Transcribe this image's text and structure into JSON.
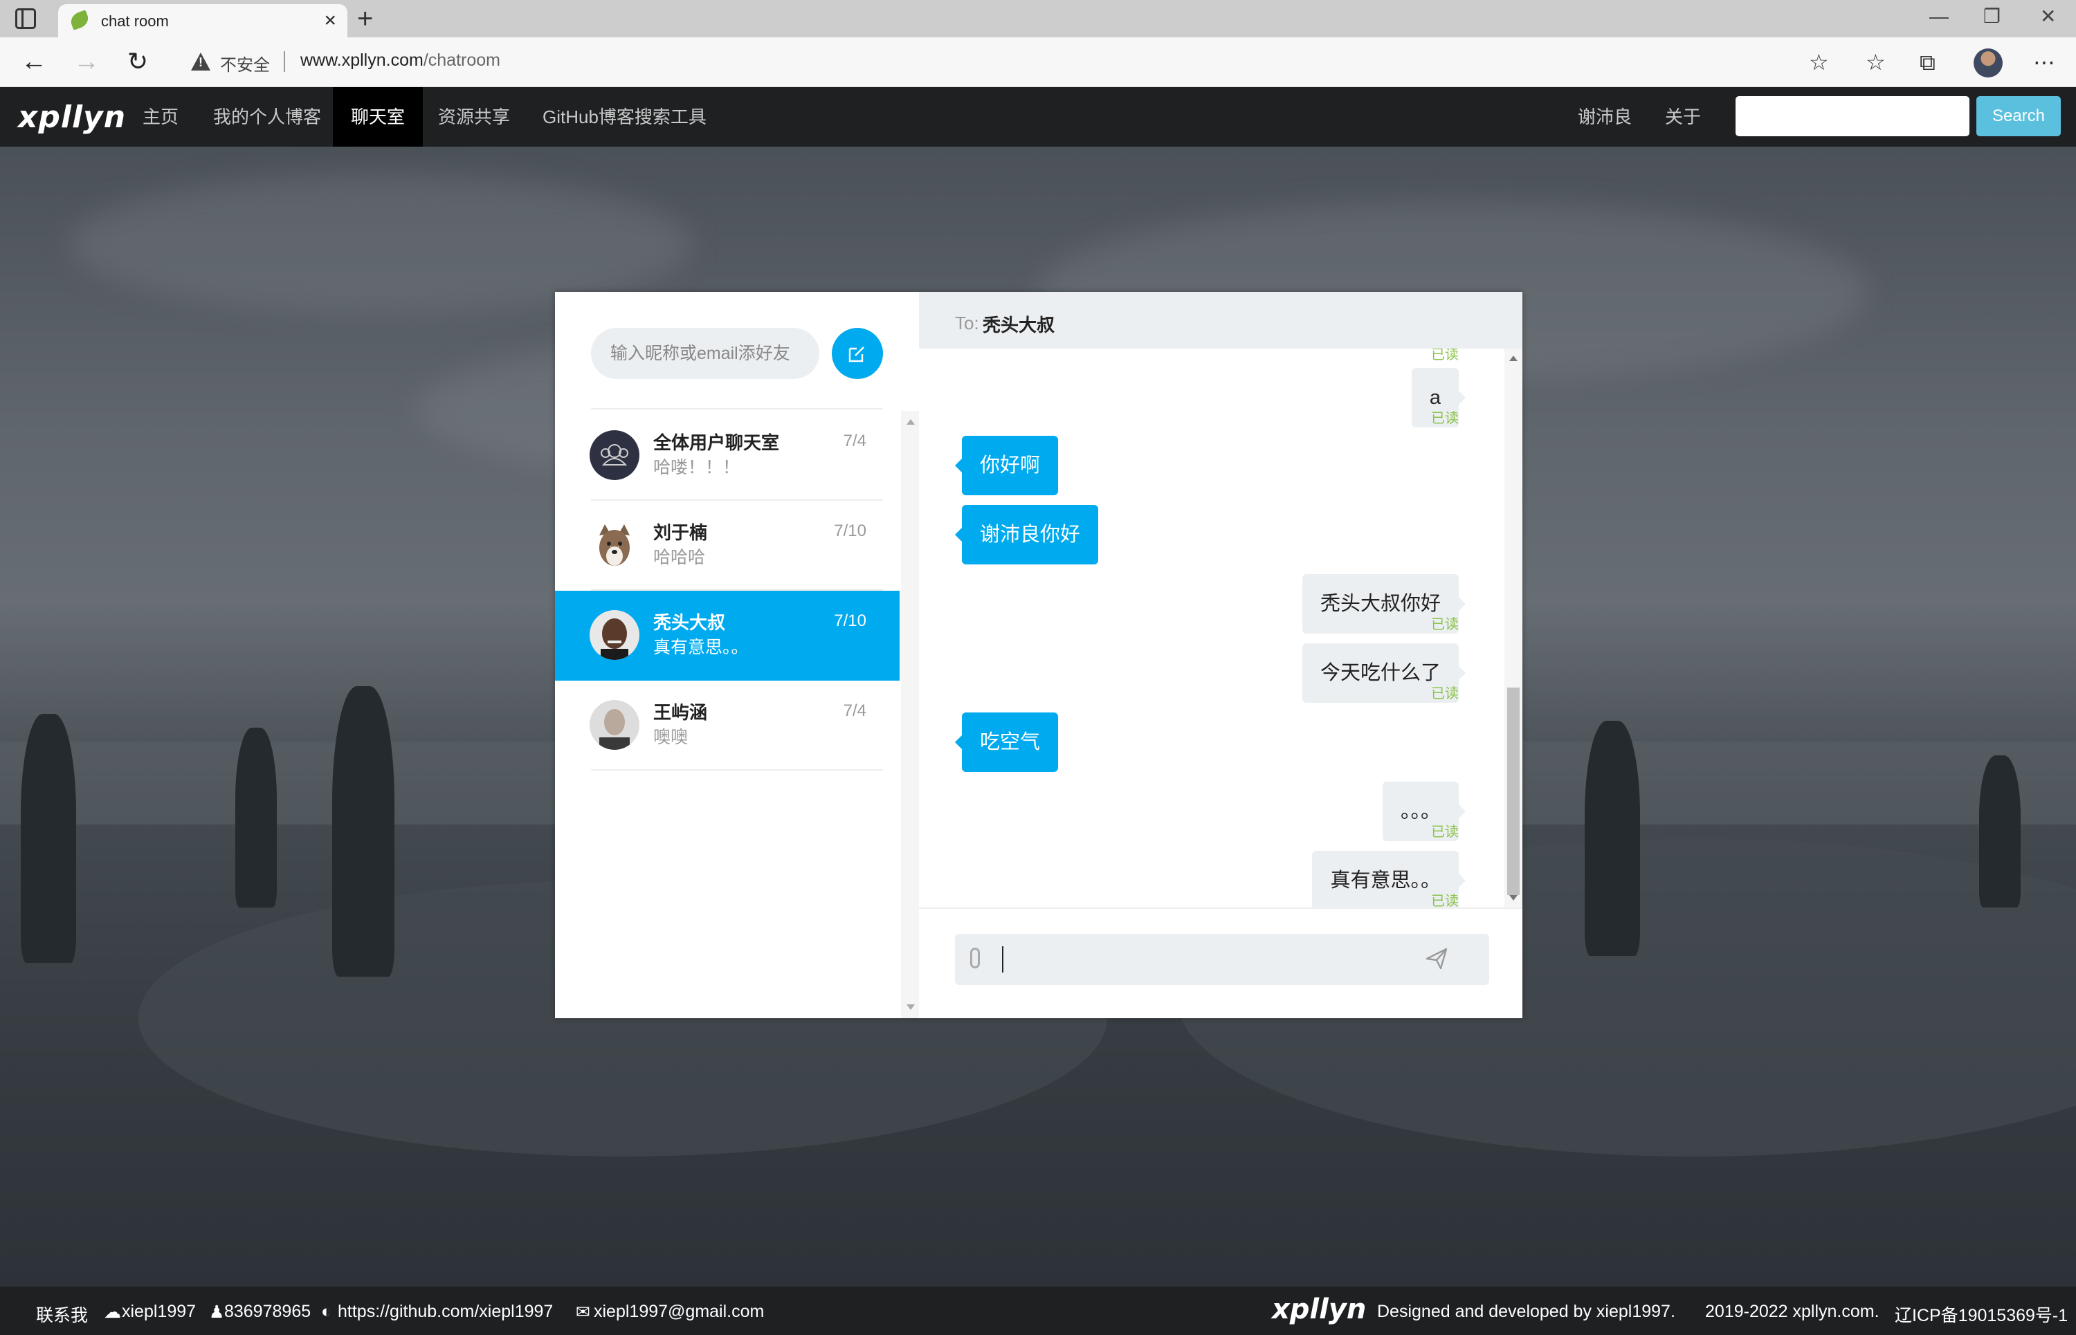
{
  "browser": {
    "tab_title": "chat room",
    "tab_close": "×",
    "new_tab": "+",
    "window_controls": [
      "—",
      "❐",
      "✕"
    ],
    "insecure_label": "不安全",
    "url_host": "www.xpllyn.com",
    "url_path": "/chatroom"
  },
  "site": {
    "logo": "xpllyn",
    "nav": [
      "主页",
      "我的个人博客",
      "聊天室",
      "资源共享",
      "GitHub博客搜索工具"
    ],
    "active_nav": "聊天室",
    "user": "谢沛良",
    "about": "关于",
    "search_value": "",
    "search_button": "Search"
  },
  "chat": {
    "add_friend_placeholder": "输入昵称或email添好友",
    "contacts": [
      {
        "name": "全体用户聊天室",
        "last": "哈喽！！！",
        "date": "7/4",
        "avatar": "group-icon"
      },
      {
        "name": "刘于楠",
        "last": "哈哈哈",
        "date": "7/10",
        "avatar": "husky-avatar"
      },
      {
        "name": "秃头大叔",
        "last": "真有意思。。",
        "date": "7/10",
        "avatar": "man-avatar",
        "active": true
      },
      {
        "name": "王屿涵",
        "last": "噢噢",
        "date": "7/4",
        "avatar": "person-avatar"
      }
    ],
    "to_label": "To:",
    "to_name": "秃头大叔",
    "messages": [
      {
        "dir": "out",
        "text": "a",
        "read": "已读"
      },
      {
        "dir": "in",
        "text": "你好啊"
      },
      {
        "dir": "in",
        "text": "谢沛良你好"
      },
      {
        "dir": "out",
        "text": "秃头大叔你好",
        "read": "已读"
      },
      {
        "dir": "out",
        "text": "今天吃什么了",
        "read": "已读"
      },
      {
        "dir": "in",
        "text": "吃空气"
      },
      {
        "dir": "out",
        "text": "。。。",
        "read": "已读"
      },
      {
        "dir": "out",
        "text": "真有意思。。",
        "read": "已读"
      }
    ],
    "top_partial_read": "已读",
    "compose_value": ""
  },
  "footer": {
    "contact": "联系我",
    "wechat": "xiepl1997",
    "qq": "836978965",
    "github": "https://github.com/xiepl1997",
    "email": "xiepl1997@gmail.com",
    "logo": "xpllyn",
    "designed": "Designed and developed by xiepl1997.",
    "copyright": "2019-2022 xpllyn.com.",
    "icp": "辽ICP备19015369号-1"
  },
  "colors": {
    "accent": "#00aaee",
    "navbar": "#1e2022",
    "read_status": "#8bc34a",
    "search_button": "#5bc0de"
  }
}
